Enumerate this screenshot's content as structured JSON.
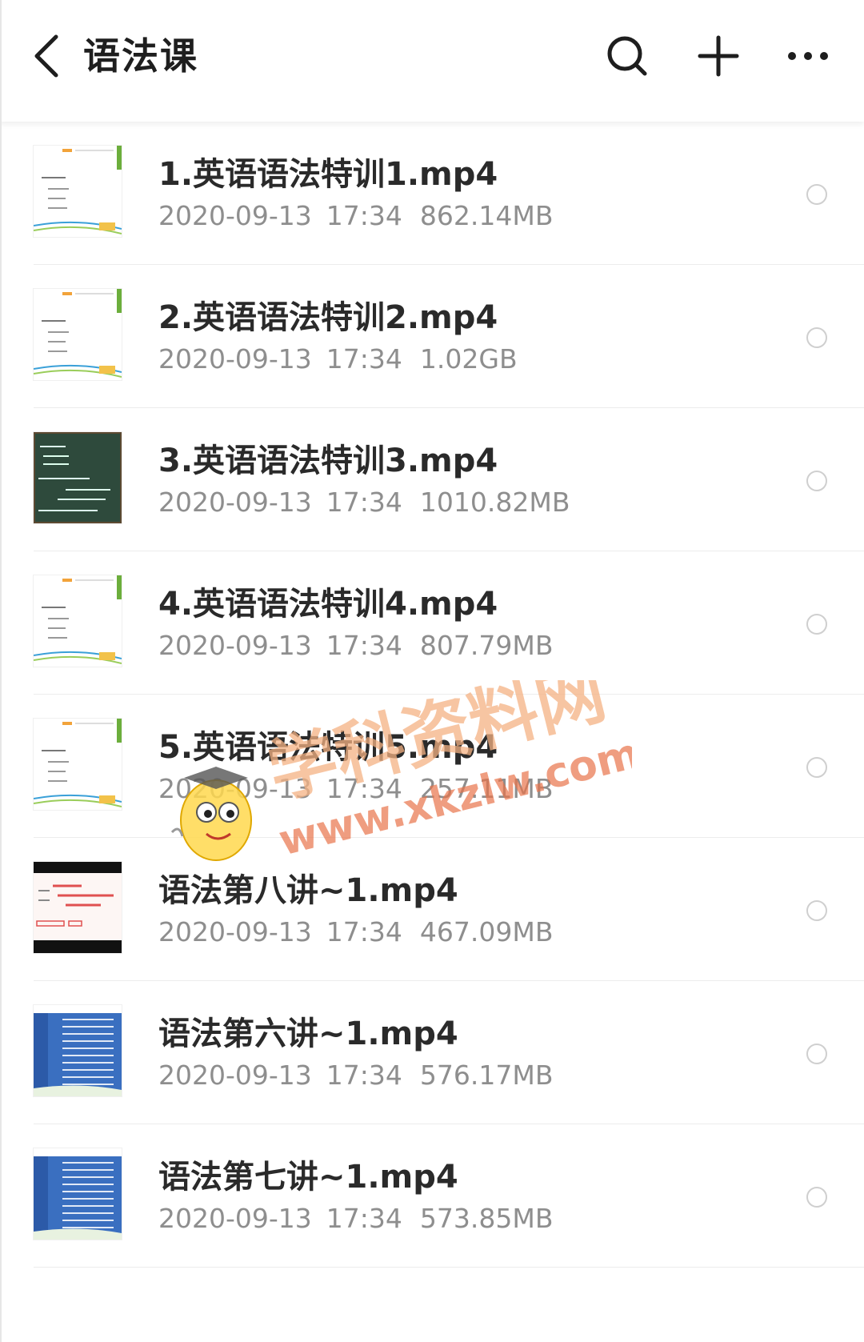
{
  "header": {
    "title": "语法课",
    "back_icon": "back-arrow-icon",
    "search_icon": "search-icon",
    "add_icon": "plus-icon",
    "more_icon": "more-dots-icon"
  },
  "files": [
    {
      "name": "1.英语语法特训1.mp4",
      "date": "2020-09-13",
      "time": "17:34",
      "size": "862.14MB",
      "thumb": "white-slide"
    },
    {
      "name": "2.英语语法特训2.mp4",
      "date": "2020-09-13",
      "time": "17:34",
      "size": "1.02GB",
      "thumb": "white-slide"
    },
    {
      "name": "3.英语语法特训3.mp4",
      "date": "2020-09-13",
      "time": "17:34",
      "size": "1010.82MB",
      "thumb": "chalkboard"
    },
    {
      "name": "4.英语语法特训4.mp4",
      "date": "2020-09-13",
      "time": "17:34",
      "size": "807.79MB",
      "thumb": "white-slide"
    },
    {
      "name": "5.英语语法特训5.mp4",
      "date": "2020-09-13",
      "time": "17:34",
      "size": "257.11MB",
      "thumb": "white-slide"
    },
    {
      "name": "语法第八讲~1.mp4",
      "date": "2020-09-13",
      "time": "17:34",
      "size": "467.09MB",
      "thumb": "video-frame"
    },
    {
      "name": "语法第六讲~1.mp4",
      "date": "2020-09-13",
      "time": "17:34",
      "size": "576.17MB",
      "thumb": "blue-table"
    },
    {
      "name": "语法第七讲~1.mp4",
      "date": "2020-09-13",
      "time": "17:34",
      "size": "573.85MB",
      "thumb": "blue-table"
    }
  ],
  "watermark": {
    "text_cn": "学科资料网",
    "text_url": "www.xkzlw.com"
  },
  "colors": {
    "title": "#1e1e1e",
    "meta": "#8e8e8e",
    "divider": "#ececec",
    "radio_border": "#cfcfcf",
    "chalkboard": "#2e4a3c",
    "table_blue": "#3a6fc0"
  }
}
